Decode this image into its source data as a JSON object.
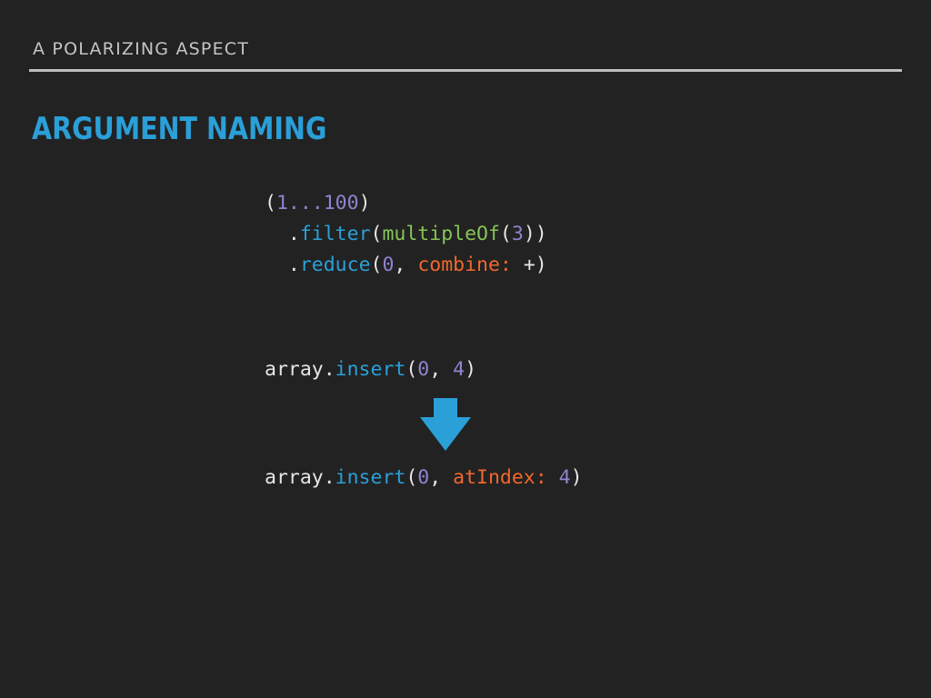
{
  "slide": {
    "kicker": "A POLARIZING ASPECT",
    "title": "ARGUMENT NAMING"
  },
  "code": {
    "block1": {
      "line1": [
        "(",
        "1...100",
        ")"
      ],
      "line2": [
        "  .",
        "filter",
        "(",
        "multipleOf",
        "(",
        "3",
        "))"
      ],
      "line3": [
        "  .",
        "reduce",
        "(",
        "0",
        ", ",
        "combine:",
        " +)"
      ]
    },
    "before": [
      "array.",
      "insert",
      "(",
      "0",
      ", ",
      "4",
      ")"
    ],
    "after": [
      "array.",
      "insert",
      "(",
      "0",
      ", ",
      "atIndex:",
      " ",
      "4",
      ")"
    ]
  },
  "colors": {
    "background": "#222222",
    "title": "#2a9fd8",
    "number": "#8f84cf",
    "method": "#2aa0d8",
    "function": "#86c457",
    "argument_label": "#f0672d",
    "arrow": "#2a9fd8"
  },
  "icons": {
    "arrow": "arrow-down-icon"
  }
}
